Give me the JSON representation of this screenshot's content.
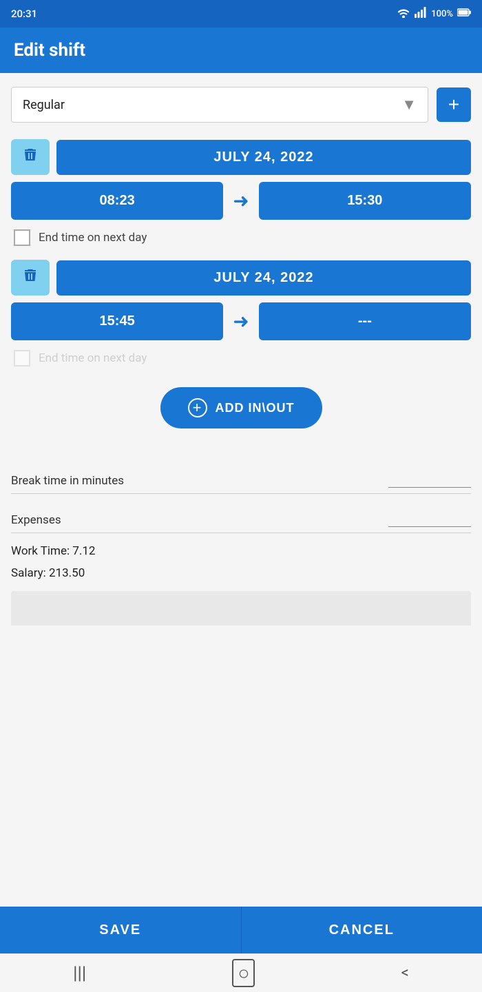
{
  "statusBar": {
    "time": "20:31",
    "battery": "100%"
  },
  "header": {
    "title": "Edit shift"
  },
  "shiftType": {
    "label": "Regular",
    "addButtonLabel": "+"
  },
  "shifts": [
    {
      "id": "shift-1",
      "date": "JULY 24, 2022",
      "startTime": "08:23",
      "endTime": "15:30",
      "endTimeOnNextDay": false,
      "endTimeOnNextDayLabel": "End time on next day",
      "endTimeEnabled": true
    },
    {
      "id": "shift-2",
      "date": "JULY 24, 2022",
      "startTime": "15:45",
      "endTime": "---",
      "endTimeOnNextDay": false,
      "endTimeOnNextDayLabel": "End time on next day",
      "endTimeEnabled": false
    }
  ],
  "addInOutButton": {
    "label": "ADD IN\\OUT"
  },
  "breakTime": {
    "label": "Break time in minutes",
    "value": ""
  },
  "expenses": {
    "label": "Expenses",
    "value": ""
  },
  "workTime": {
    "label": "Work Time:",
    "value": "7.12"
  },
  "salary": {
    "label": "Salary:",
    "value": "213.50"
  },
  "buttons": {
    "save": "SAVE",
    "cancel": "CANCEL"
  },
  "nav": {
    "menu": "|||",
    "home": "○",
    "back": "<"
  }
}
